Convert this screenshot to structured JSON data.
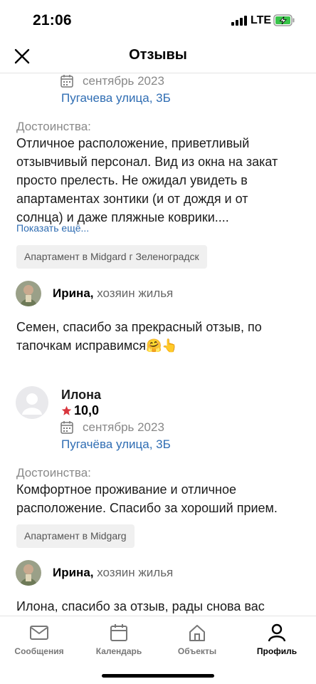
{
  "status_bar": {
    "time": "21:06",
    "network": "LTE",
    "icons": [
      "signal-icon",
      "battery-charging-icon"
    ]
  },
  "header": {
    "title": "Отзывы",
    "close_icon": "close-icon"
  },
  "reviews": [
    {
      "date": "сентябрь 2023",
      "address": "Пугачева улица, 3Б",
      "pros_label": "Достоинства:",
      "pros_lines": [
        "Отличное расположение, приветливый",
        "отзывчивый персонал. Вид из окна на закат",
        "просто прелесть. Не ожидал увидеть в",
        "апартаментах зонтики (и от дождя и от",
        "солнца) и даже пляжные коврики...."
      ],
      "show_more": "Показать ещё...",
      "listing": "Апартамент в Midgard г Зеленоградск",
      "reply": {
        "author": "Ирина,",
        "role": "хозяин жилья",
        "lines": [
          "Семен, спасибо за прекрасный отзыв, по",
          "тапочкам исправимся🤗👆"
        ]
      }
    },
    {
      "author": "Илона",
      "rating": "10,0",
      "date": "сентябрь 2023",
      "address": "Пугачёва улица, 3Б",
      "pros_label": "Достоинства:",
      "pros_lines": [
        "Комфортное проживание и отличное",
        "расположение. Спасибо за хороший прием."
      ],
      "listing": "Апартамент в Midgarg",
      "reply": {
        "author": "Ирина,",
        "role": "хозяин жилья",
        "lines": [
          "Илона, спасибо за отзыв, рады снова вас"
        ]
      }
    }
  ],
  "tab_bar": {
    "tabs": [
      {
        "label": "Сообщения",
        "icon": "mail-icon",
        "active": false
      },
      {
        "label": "Календарь",
        "icon": "calendar-icon",
        "active": false
      },
      {
        "label": "Объекты",
        "icon": "home-icon",
        "active": false
      },
      {
        "label": "Профиль",
        "icon": "person-icon",
        "active": true
      }
    ]
  },
  "colors": {
    "link": "#2f6db3",
    "star": "#d9363e",
    "muted": "#888888"
  }
}
